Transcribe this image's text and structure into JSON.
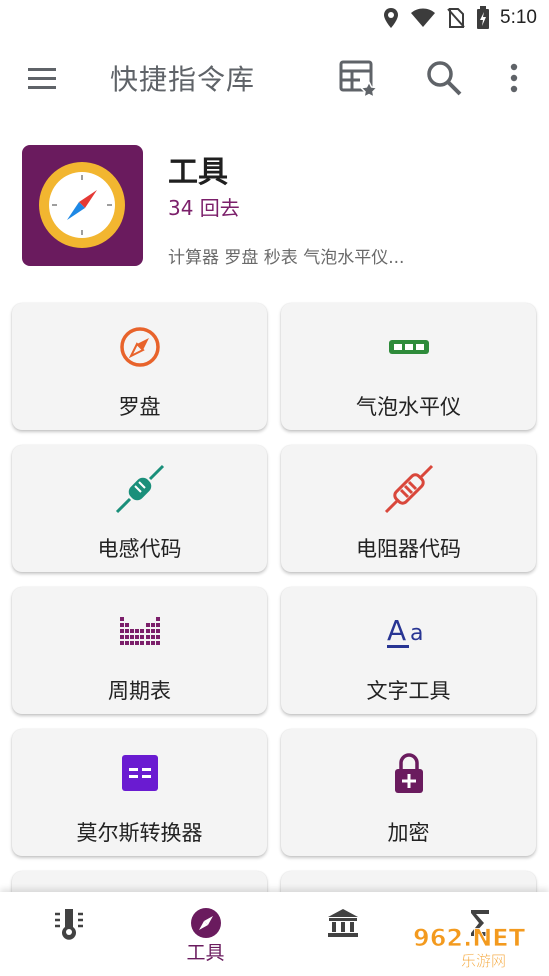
{
  "status": {
    "time": "5:10"
  },
  "appbar": {
    "title": "快捷指令库"
  },
  "hero": {
    "title": "工具",
    "subtitle": "34 回去",
    "description": "计算器 罗盘 秒表 气泡水平仪..."
  },
  "tools": [
    {
      "label": "罗盘",
      "icon": "compass-icon"
    },
    {
      "label": "气泡水平仪",
      "icon": "bubble-level-icon"
    },
    {
      "label": "电感代码",
      "icon": "inductor-icon"
    },
    {
      "label": "电阻器代码",
      "icon": "resistor-icon"
    },
    {
      "label": "周期表",
      "icon": "periodic-table-icon"
    },
    {
      "label": "文字工具",
      "icon": "text-tool-icon"
    },
    {
      "label": "莫尔斯转换器",
      "icon": "morse-converter-icon"
    },
    {
      "label": "加密",
      "icon": "lock-icon"
    }
  ],
  "bottomnav": {
    "active_label": "工具"
  },
  "watermark": {
    "text": "962.NET",
    "subtext": "乐游网"
  },
  "colors": {
    "brand": "#6a1b5e",
    "compass": "#e8632b",
    "level": "#2e8b3a",
    "inductor": "#1a8f7a",
    "resistor": "#d9473b",
    "periodic": "#7b1f6a",
    "text_tool": "#283593",
    "morse": "#6a1bd1"
  }
}
